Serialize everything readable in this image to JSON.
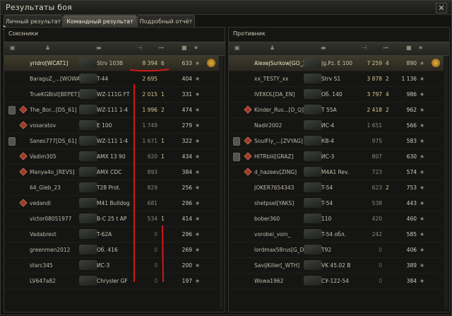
{
  "window": {
    "title": "Результаты боя",
    "close": "✕"
  },
  "tabs": [
    {
      "label": "Личный результат"
    },
    {
      "label": "Командный результат",
      "active": true
    },
    {
      "label": "Подробный отчёт"
    }
  ],
  "allies": {
    "title": "Союзники",
    "rows": [
      {
        "name": "yridro[WCAT1]",
        "tank": "Strv 103B",
        "dmg": "8 394",
        "kills": "6",
        "xp": "633",
        "hl": true,
        "medal": true
      },
      {
        "name": "BaraguZ_...[WOWAC]",
        "tank": "T-44",
        "dmg": "2 695",
        "kills": "",
        "xp": "404"
      },
      {
        "name": "TrueKGBist[BEPET]",
        "tank": "WZ-111G FT",
        "dmg": "2 015",
        "kills": "1",
        "xp": "331"
      },
      {
        "name": "The_Bor...[DS_61]",
        "tank": "WZ-111 1-4",
        "dmg": "1 996",
        "kills": "2",
        "xp": "474",
        "badge": true,
        "diamond": true
      },
      {
        "name": "vosaratov",
        "tank": "E 100",
        "dmg": "1 749",
        "kills": "",
        "xp": "279",
        "diamond": true
      },
      {
        "name": "Sanes777[DS_61]",
        "tank": "WZ-111 1-4",
        "dmg": "1 671",
        "kills": "1",
        "xp": "322",
        "badge": true
      },
      {
        "name": "Vadim305",
        "tank": "AMX 13 90",
        "dmg": "920",
        "kills": "1",
        "xp": "434",
        "diamond": true
      },
      {
        "name": "Manya4o_[REVS]",
        "tank": "AMX CDC",
        "dmg": "893",
        "kills": "",
        "xp": "384",
        "diamond": true
      },
      {
        "name": "64_Gleb_23",
        "tank": "T28 Prot.",
        "dmg": "829",
        "kills": "",
        "xp": "256"
      },
      {
        "name": "vedandi",
        "tank": "M41 Bulldog",
        "dmg": "681",
        "kills": "",
        "xp": "296",
        "diamond": true
      },
      {
        "name": "victor08051977",
        "tank": "B-C 25 t AP",
        "dmg": "534",
        "kills": "1",
        "xp": "414"
      },
      {
        "name": "Vadabrest",
        "tank": "T-62A",
        "dmg": "0",
        "kills": "",
        "xp": "296"
      },
      {
        "name": "greenmen2012",
        "tank": "Об. 416",
        "dmg": "0",
        "kills": "",
        "xp": "269"
      },
      {
        "name": "starc345",
        "tank": "ИС-3",
        "dmg": "0",
        "kills": "",
        "xp": "200"
      },
      {
        "name": "LV647a82",
        "tank": "Chrysler GF",
        "dmg": "0",
        "kills": "",
        "xp": "197"
      }
    ]
  },
  "enemies": {
    "title": "Противник",
    "rows": [
      {
        "name": "AlexejSurkow[GO_]",
        "tank": "Jg.Pz. E 100",
        "dmg": "7 259",
        "kills": "4",
        "xp": "890",
        "hl": true,
        "medal": true
      },
      {
        "name": "xx_TESTY_xx",
        "tank": "Strv S1",
        "dmg": "3 878",
        "kills": "2",
        "xp": "1 136"
      },
      {
        "name": "IVEKOL[DA_EN]",
        "tank": "Об. 140",
        "dmg": "3 797",
        "kills": "4",
        "xp": "986"
      },
      {
        "name": "Kinder_Rus...[D_Q]",
        "tank": "T 55A",
        "dmg": "2 418",
        "kills": "2",
        "xp": "962",
        "diamond": true
      },
      {
        "name": "Nadir2002",
        "tank": "ИС-4",
        "dmg": "1 651",
        "kills": "",
        "xp": "566"
      },
      {
        "name": "SoulFly_...[ZVYAG]",
        "tank": "КВ-4",
        "dmg": "975",
        "kills": "",
        "xp": "583",
        "badge": true,
        "diamond": true
      },
      {
        "name": "HITRblii[GRAZ]",
        "tank": "ИС-3",
        "dmg": "807",
        "kills": "",
        "xp": "630",
        "badge": true,
        "diamond": true
      },
      {
        "name": "d_hazeev[ZING]",
        "tank": "M4A1 Rev.",
        "dmg": "723",
        "kills": "",
        "xp": "574",
        "diamond": true
      },
      {
        "name": "JOKER7654343",
        "tank": "T-54",
        "dmg": "623",
        "kills": "2",
        "xp": "753"
      },
      {
        "name": "shetpsel[YAKS]",
        "tank": "T-54",
        "dmg": "538",
        "kills": "",
        "xp": "443"
      },
      {
        "name": "bober360",
        "tank": "110",
        "dmg": "420",
        "kills": "",
        "xp": "460"
      },
      {
        "name": "vorobei_voin_",
        "tank": "T-54 обл.",
        "dmg": "242",
        "kills": "",
        "xp": "585"
      },
      {
        "name": "lordmax58rus[G_D_7]",
        "tank": "T92",
        "dmg": "0",
        "kills": "",
        "xp": "406"
      },
      {
        "name": "SaviJKiller[_WTH]",
        "tank": "VK 45.02 B",
        "dmg": "0",
        "kills": "",
        "xp": "389"
      },
      {
        "name": "Wowa1962",
        "tank": "СУ-122-54",
        "dmg": "0",
        "kills": "",
        "xp": "384"
      }
    ]
  },
  "colors": {
    "accent": "#e8c860",
    "annotation": "#d01818",
    "highlight_row": "#3e3a2c"
  }
}
